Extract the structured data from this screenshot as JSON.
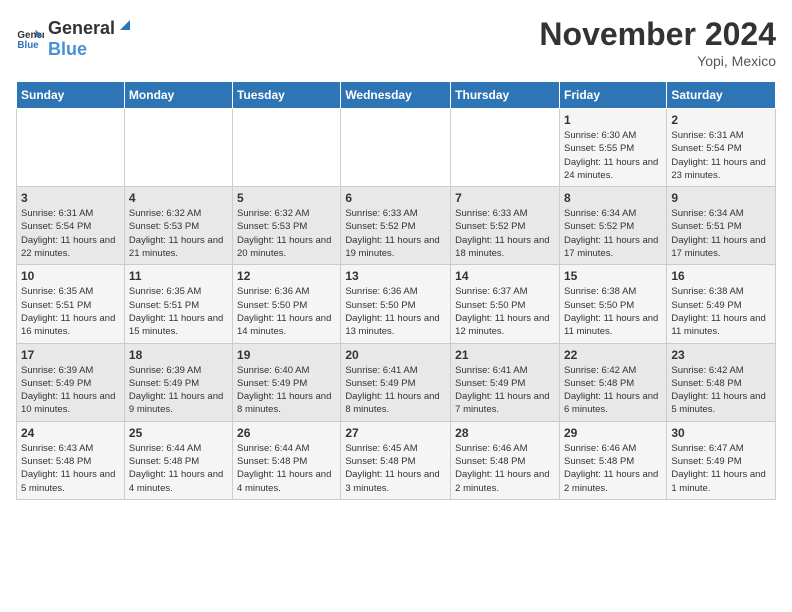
{
  "logo": {
    "general": "General",
    "blue": "Blue"
  },
  "header": {
    "month": "November 2024",
    "location": "Yopi, Mexico"
  },
  "weekdays": [
    "Sunday",
    "Monday",
    "Tuesday",
    "Wednesday",
    "Thursday",
    "Friday",
    "Saturday"
  ],
  "weeks": [
    [
      {
        "day": "",
        "info": ""
      },
      {
        "day": "",
        "info": ""
      },
      {
        "day": "",
        "info": ""
      },
      {
        "day": "",
        "info": ""
      },
      {
        "day": "",
        "info": ""
      },
      {
        "day": "1",
        "info": "Sunrise: 6:30 AM\nSunset: 5:55 PM\nDaylight: 11 hours and 24 minutes."
      },
      {
        "day": "2",
        "info": "Sunrise: 6:31 AM\nSunset: 5:54 PM\nDaylight: 11 hours and 23 minutes."
      }
    ],
    [
      {
        "day": "3",
        "info": "Sunrise: 6:31 AM\nSunset: 5:54 PM\nDaylight: 11 hours and 22 minutes."
      },
      {
        "day": "4",
        "info": "Sunrise: 6:32 AM\nSunset: 5:53 PM\nDaylight: 11 hours and 21 minutes."
      },
      {
        "day": "5",
        "info": "Sunrise: 6:32 AM\nSunset: 5:53 PM\nDaylight: 11 hours and 20 minutes."
      },
      {
        "day": "6",
        "info": "Sunrise: 6:33 AM\nSunset: 5:52 PM\nDaylight: 11 hours and 19 minutes."
      },
      {
        "day": "7",
        "info": "Sunrise: 6:33 AM\nSunset: 5:52 PM\nDaylight: 11 hours and 18 minutes."
      },
      {
        "day": "8",
        "info": "Sunrise: 6:34 AM\nSunset: 5:52 PM\nDaylight: 11 hours and 17 minutes."
      },
      {
        "day": "9",
        "info": "Sunrise: 6:34 AM\nSunset: 5:51 PM\nDaylight: 11 hours and 17 minutes."
      }
    ],
    [
      {
        "day": "10",
        "info": "Sunrise: 6:35 AM\nSunset: 5:51 PM\nDaylight: 11 hours and 16 minutes."
      },
      {
        "day": "11",
        "info": "Sunrise: 6:35 AM\nSunset: 5:51 PM\nDaylight: 11 hours and 15 minutes."
      },
      {
        "day": "12",
        "info": "Sunrise: 6:36 AM\nSunset: 5:50 PM\nDaylight: 11 hours and 14 minutes."
      },
      {
        "day": "13",
        "info": "Sunrise: 6:36 AM\nSunset: 5:50 PM\nDaylight: 11 hours and 13 minutes."
      },
      {
        "day": "14",
        "info": "Sunrise: 6:37 AM\nSunset: 5:50 PM\nDaylight: 11 hours and 12 minutes."
      },
      {
        "day": "15",
        "info": "Sunrise: 6:38 AM\nSunset: 5:50 PM\nDaylight: 11 hours and 11 minutes."
      },
      {
        "day": "16",
        "info": "Sunrise: 6:38 AM\nSunset: 5:49 PM\nDaylight: 11 hours and 11 minutes."
      }
    ],
    [
      {
        "day": "17",
        "info": "Sunrise: 6:39 AM\nSunset: 5:49 PM\nDaylight: 11 hours and 10 minutes."
      },
      {
        "day": "18",
        "info": "Sunrise: 6:39 AM\nSunset: 5:49 PM\nDaylight: 11 hours and 9 minutes."
      },
      {
        "day": "19",
        "info": "Sunrise: 6:40 AM\nSunset: 5:49 PM\nDaylight: 11 hours and 8 minutes."
      },
      {
        "day": "20",
        "info": "Sunrise: 6:41 AM\nSunset: 5:49 PM\nDaylight: 11 hours and 8 minutes."
      },
      {
        "day": "21",
        "info": "Sunrise: 6:41 AM\nSunset: 5:49 PM\nDaylight: 11 hours and 7 minutes."
      },
      {
        "day": "22",
        "info": "Sunrise: 6:42 AM\nSunset: 5:48 PM\nDaylight: 11 hours and 6 minutes."
      },
      {
        "day": "23",
        "info": "Sunrise: 6:42 AM\nSunset: 5:48 PM\nDaylight: 11 hours and 5 minutes."
      }
    ],
    [
      {
        "day": "24",
        "info": "Sunrise: 6:43 AM\nSunset: 5:48 PM\nDaylight: 11 hours and 5 minutes."
      },
      {
        "day": "25",
        "info": "Sunrise: 6:44 AM\nSunset: 5:48 PM\nDaylight: 11 hours and 4 minutes."
      },
      {
        "day": "26",
        "info": "Sunrise: 6:44 AM\nSunset: 5:48 PM\nDaylight: 11 hours and 4 minutes."
      },
      {
        "day": "27",
        "info": "Sunrise: 6:45 AM\nSunset: 5:48 PM\nDaylight: 11 hours and 3 minutes."
      },
      {
        "day": "28",
        "info": "Sunrise: 6:46 AM\nSunset: 5:48 PM\nDaylight: 11 hours and 2 minutes."
      },
      {
        "day": "29",
        "info": "Sunrise: 6:46 AM\nSunset: 5:48 PM\nDaylight: 11 hours and 2 minutes."
      },
      {
        "day": "30",
        "info": "Sunrise: 6:47 AM\nSunset: 5:49 PM\nDaylight: 11 hours and 1 minute."
      }
    ]
  ]
}
